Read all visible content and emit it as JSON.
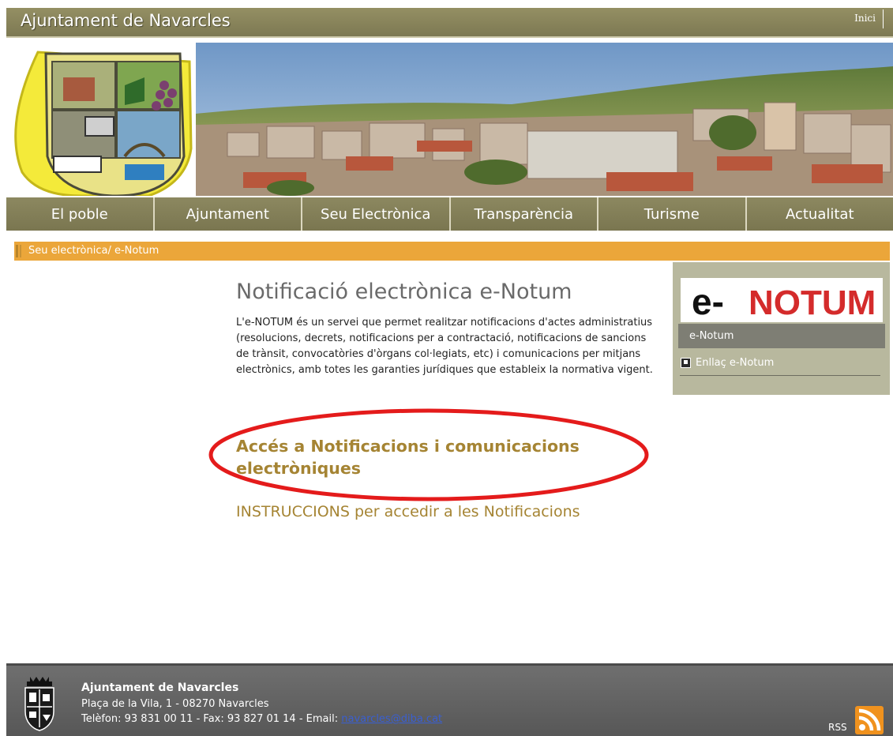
{
  "header": {
    "site_title": "Ajuntament de Navarcles",
    "home_link": "Inici"
  },
  "nav": {
    "items": [
      {
        "label": "El poble"
      },
      {
        "label": "Ajuntament"
      },
      {
        "label": "Seu Electrònica"
      },
      {
        "label": "Transparència"
      },
      {
        "label": "Turisme"
      },
      {
        "label": "Actualitat"
      }
    ]
  },
  "breadcrumb": {
    "text": "Seu electrònica/ e-Notum"
  },
  "main": {
    "title": "Notificació electrònica e-Notum",
    "description": "L'e-NOTUM és un servei que permet realitzar notificacions d'actes administratius (resolucions, decrets, notificacions per a contractació, notificacions de sancions de trànsit, convocatòries d'òrgans col·legiats, etc) i comunicacions per mitjans electrònics, amb totes les garanties jurídiques que estableix la normativa vigent.",
    "access_link": "Accés a Notificacions i comunicacions electròniques",
    "instructions_link": "INSTRUCCIONS per accedir a les Notificacions"
  },
  "sidebar": {
    "logo_text_e": "e-",
    "logo_text_notum": "NOTUM",
    "section_title": "e-Notum",
    "link_label": "Enllaç e-Notum"
  },
  "footer": {
    "name": "Ajuntament de Navarcles",
    "address": "Plaça de la Vila, 1 - 08270 Navarcles",
    "contact_prefix": "Telèfon: 93 831 00 11 - Fax: 93 827 01 14 - Email: ",
    "email": "navarcles@diba.cat",
    "rss_label": "RSS"
  },
  "colors": {
    "header_olive": "#8c8860",
    "breadcrumb_orange": "#eba63a",
    "link_gold": "#a58433",
    "highlight_red": "#e41b1b",
    "sidebar_bg": "#b8b89e",
    "footer_grey": "#626262",
    "enotum_red": "#d42b2b"
  }
}
